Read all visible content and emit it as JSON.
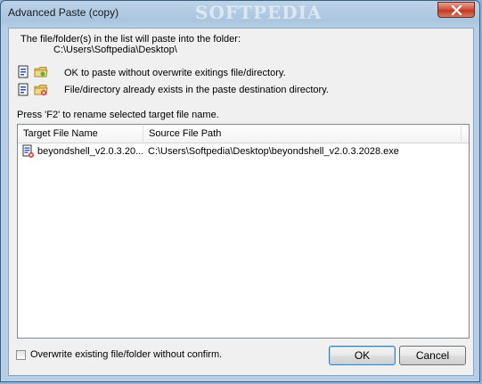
{
  "window": {
    "title": "Advanced Paste (copy)",
    "watermark": "SOFTPEDIA"
  },
  "intro": {
    "line1": "The file/folder(s) in the list will paste into the folder:",
    "path": "C:\\Users\\Softpedia\\Desktop\\"
  },
  "legend": [
    {
      "text": "OK to paste without overwrite exitings file/directory.",
      "icon": "folder-ok-icon"
    },
    {
      "text": "File/directory already exists in the paste destination directory.",
      "icon": "folder-conflict-icon"
    }
  ],
  "rename_hint": "Press 'F2' to rename selected target file name.",
  "list": {
    "columns": [
      "Target File Name",
      "Source File Path"
    ],
    "rows": [
      {
        "target": "beyondshell_v2.0.3.20...",
        "source": "C:\\Users\\Softpedia\\Desktop\\beyondshell_v2.0.3.2028.exe",
        "status_icon": "file-conflict-icon"
      }
    ]
  },
  "overwrite_checkbox": {
    "label": "Overwrite existing file/folder without confirm.",
    "checked": false
  },
  "buttons": {
    "ok": "OK",
    "cancel": "Cancel"
  },
  "colors": {
    "title_bar": "#a9c5df",
    "close_button": "#c23a22",
    "default_button_border": "#3c7fb1"
  }
}
